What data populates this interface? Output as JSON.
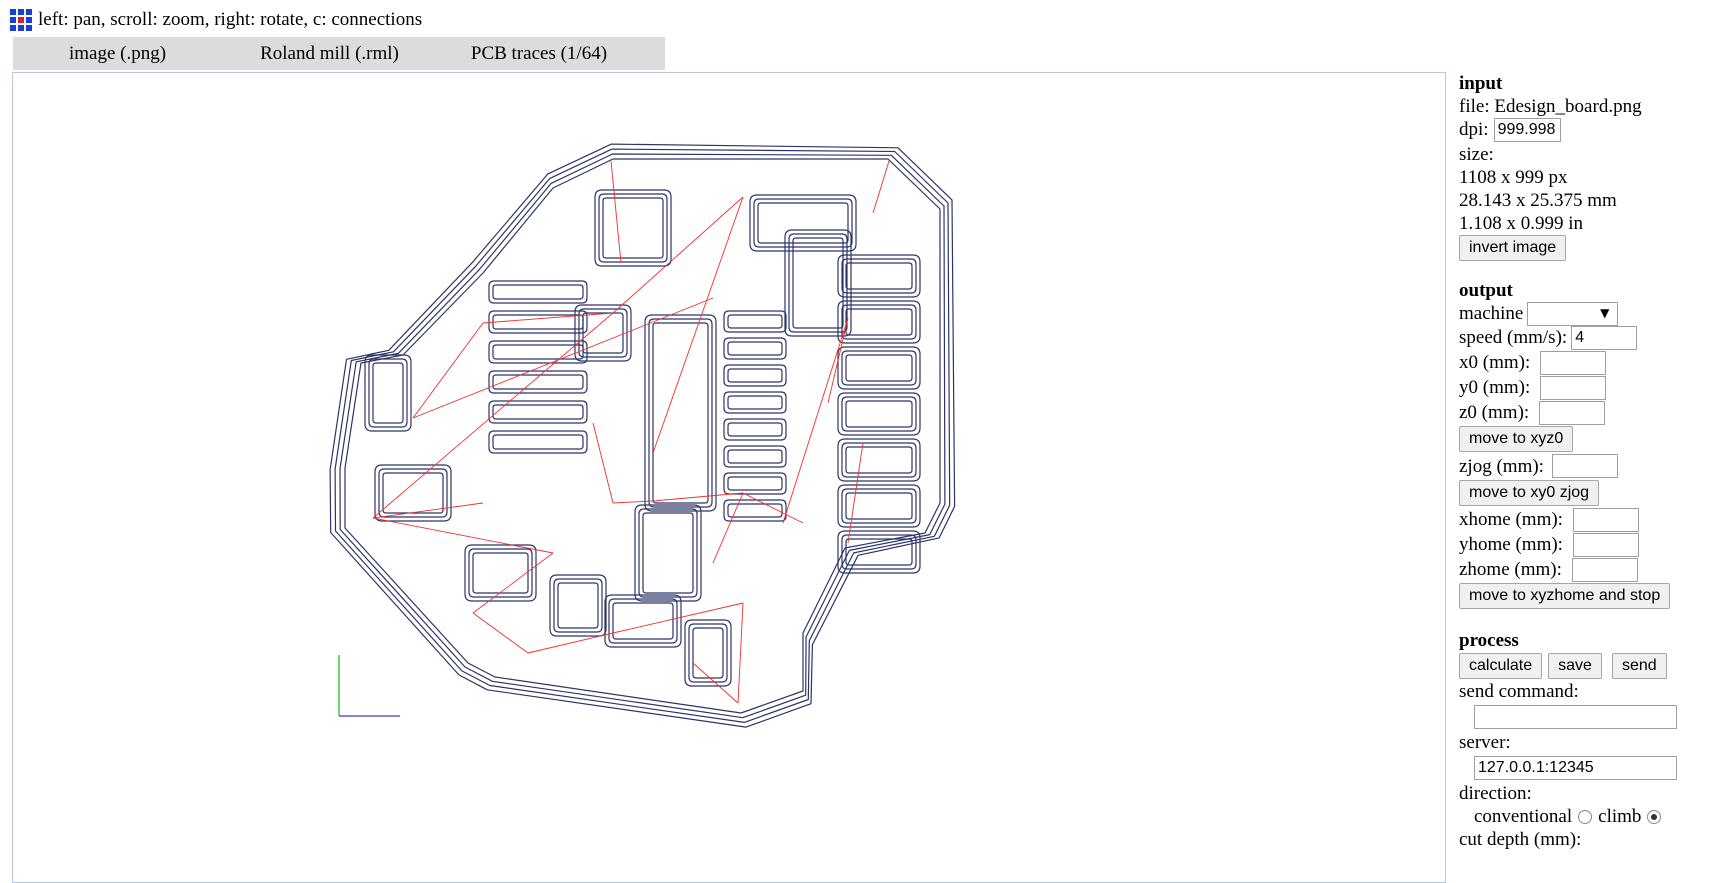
{
  "header": {
    "hint": "left: pan, scroll: zoom, right: rotate, c: connections",
    "icon": "fab-modules-grid-icon"
  },
  "modules": [
    {
      "label": "image (.png)"
    },
    {
      "label": "Roland mill (.rml)"
    },
    {
      "label": "PCB traces (1/64)"
    }
  ],
  "colors": {
    "toolpath": "#2e3566",
    "connection": "#f03030",
    "axis_x": "#3a3ad0",
    "axis_y": "#22c022",
    "module_bar": "#dcdcdc"
  },
  "panel": {
    "input": {
      "heading": "input",
      "file": "file: Edesign_board.png",
      "dpi_label": "dpi:",
      "dpi_value": "999.998",
      "size_label": "size:",
      "size_px": "1108 x 999 px",
      "size_mm": "28.143 x 25.375 mm",
      "size_in": "1.108 x 0.999 in",
      "invert_button": "invert image"
    },
    "output": {
      "heading": "output",
      "machine_label": "machine",
      "machine_value": "",
      "speed_label": "speed (mm/s):",
      "speed_value": "4",
      "x0_label": "x0 (mm):",
      "x0_value": "",
      "y0_label": "y0 (mm):",
      "y0_value": "",
      "z0_label": "z0 (mm):",
      "z0_value": "",
      "move_xyz0_button": "move to xyz0",
      "zjog_label": "zjog (mm):",
      "zjog_value": "",
      "move_xy0_button": "move to xy0 zjog",
      "xhome_label": "xhome (mm):",
      "xhome_value": "",
      "yhome_label": "yhome (mm):",
      "yhome_value": "",
      "zhome_label": "zhome (mm):",
      "zhome_value": "",
      "move_home_button": "move to xyzhome and stop"
    },
    "process": {
      "heading": "process",
      "calculate_button": "calculate",
      "save_button": "save",
      "send_button": "send",
      "send_command_label": "send command:",
      "send_command_value": "",
      "server_label": "server:",
      "server_value": "127.0.0.1:12345",
      "direction_label": "direction:",
      "conventional_label": "conventional",
      "climb_label": "climb",
      "direction_selected": "climb",
      "cut_depth_label": "cut depth (mm):"
    }
  }
}
